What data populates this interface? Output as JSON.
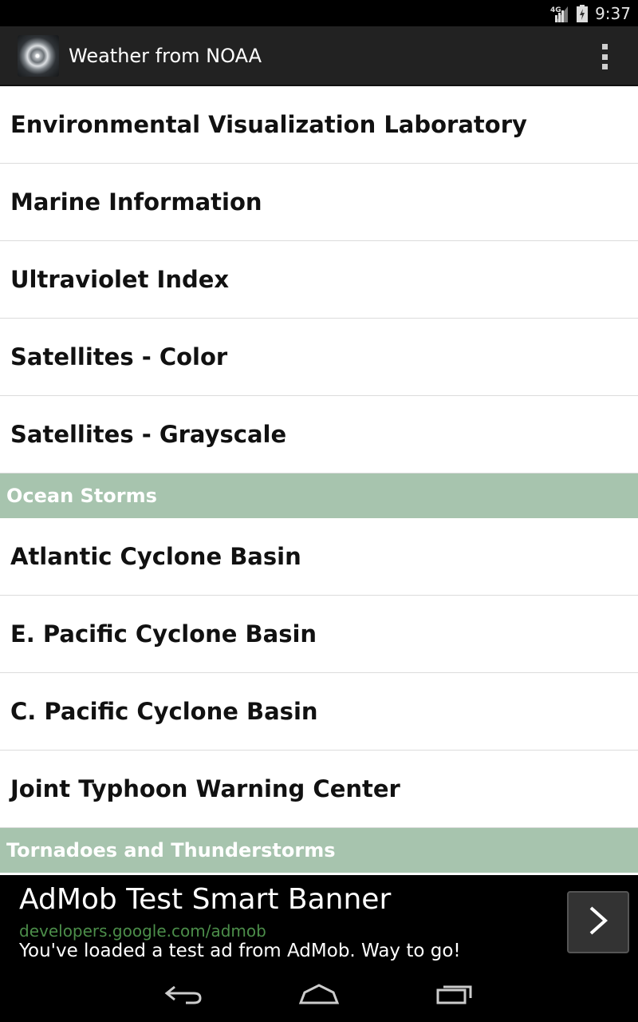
{
  "status_bar": {
    "time": "9:37",
    "network_label": "4G",
    "icons": [
      "signal-icon",
      "battery-icon"
    ]
  },
  "action_bar": {
    "title": "Weather from NOAA",
    "icons": [
      "app-icon",
      "overflow-menu-icon"
    ]
  },
  "list": {
    "items_top": [
      "Environmental Visualization Laboratory",
      "Marine Information",
      "Ultraviolet Index",
      "Satellites - Color",
      "Satellites - Grayscale"
    ],
    "section_ocean_storms": "Ocean Storms",
    "items_ocean_storms": [
      "Atlantic Cyclone Basin",
      "E. Pacific Cyclone Basin",
      "C. Pacific Cyclone Basin",
      "Joint Typhoon Warning Center"
    ],
    "section_tornadoes": "Tornadoes and Thunderstorms",
    "section_color": "#a7c4ae"
  },
  "ad": {
    "title": "AdMob Test Smart Banner",
    "url": "developers.google.com/admob",
    "description": "You've loaded a test ad from AdMob. Way to go!",
    "icon": "chevron-right-icon"
  },
  "nav_bar": {
    "icons": [
      "back-icon",
      "home-icon",
      "recent-apps-icon"
    ]
  }
}
